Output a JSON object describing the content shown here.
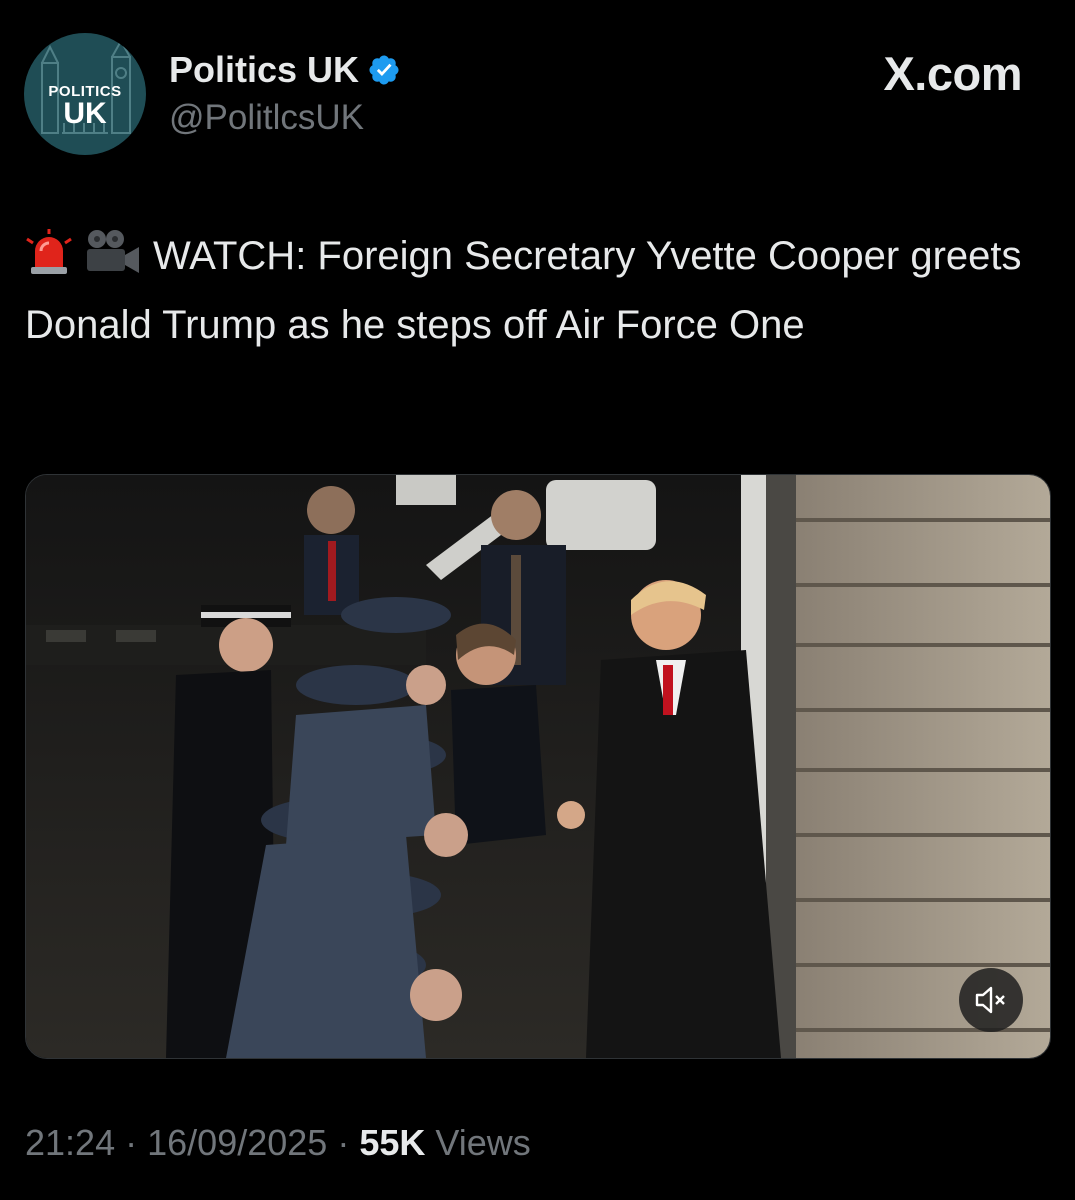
{
  "account": {
    "display_name": "Politics UK",
    "handle": "@PolitlcsUK",
    "verified": true,
    "avatar_line1": "POLITICS",
    "avatar_line2": "UK"
  },
  "brand": "X.com",
  "tweet": {
    "emojis": [
      "rotating-light-icon",
      "movie-camera-icon"
    ],
    "text": "WATCH: Foreign Secretary Yvette Cooper greets Donald Trump as he steps off Air Force One"
  },
  "media": {
    "type": "video",
    "muted": true,
    "mute_icon": "speaker-muted-icon"
  },
  "meta": {
    "time": "21:24",
    "date": "16/09/2025",
    "separator": "·",
    "views_count": "55K",
    "views_label": "Views"
  },
  "colors": {
    "background": "#000000",
    "text": "#e7e9ea",
    "secondary": "#71767b",
    "verified": "#1d9bf0",
    "avatar": "#1f4d55"
  }
}
